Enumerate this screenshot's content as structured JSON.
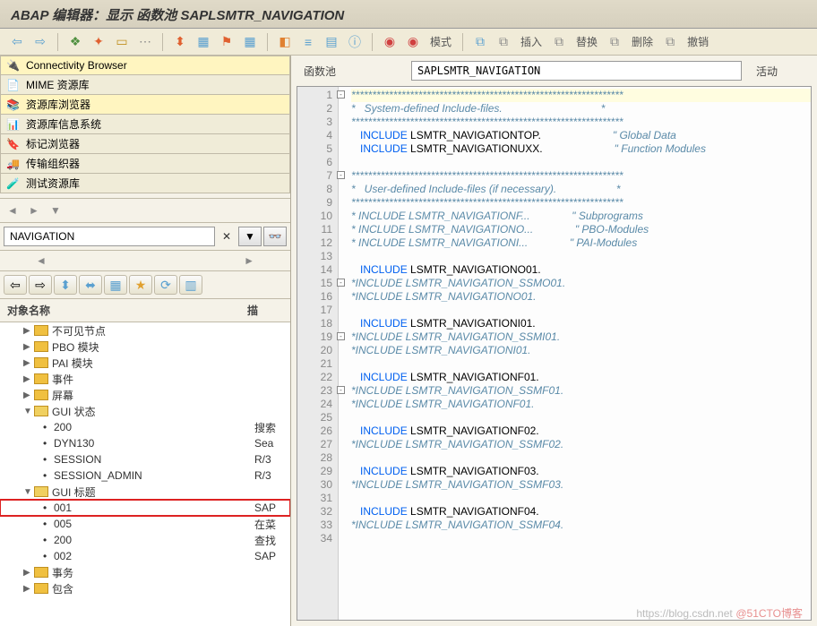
{
  "title": "ABAP 编辑器：显示 函数池 SAPLSMTR_NAVIGATION",
  "toolbar": {
    "mode": "模式",
    "insert": "插入",
    "replace": "替换",
    "delete": "删除",
    "undo": "撤销"
  },
  "browsers": [
    {
      "label": "Connectivity Browser",
      "hl": true
    },
    {
      "label": "MIME 资源库"
    },
    {
      "label": "资源库浏览器",
      "hl": true
    },
    {
      "label": "资源库信息系统"
    },
    {
      "label": "标记浏览器"
    },
    {
      "label": "传输组织器"
    },
    {
      "label": "测试资源库"
    }
  ],
  "search": {
    "value": "NAVIGATION"
  },
  "tree": {
    "header": {
      "c1": "对象名称",
      "c2": "描"
    },
    "nodes": [
      {
        "indent": 1,
        "exp": "▶",
        "folder": 1,
        "label": "不可见节点"
      },
      {
        "indent": 1,
        "exp": "▶",
        "folder": 1,
        "label": "PBO 模块"
      },
      {
        "indent": 1,
        "exp": "▶",
        "folder": 1,
        "label": "PAI 模块"
      },
      {
        "indent": 1,
        "exp": "▶",
        "folder": 1,
        "label": "事件"
      },
      {
        "indent": 1,
        "exp": "▶",
        "folder": 1,
        "label": "屏幕"
      },
      {
        "indent": 1,
        "exp": "▼",
        "folder": 2,
        "label": "GUI 状态"
      },
      {
        "indent": 2,
        "dot": 1,
        "label": "200",
        "desc": "搜索"
      },
      {
        "indent": 2,
        "dot": 1,
        "label": "DYN130",
        "desc": "Sea"
      },
      {
        "indent": 2,
        "dot": 1,
        "label": "SESSION",
        "desc": "R/3"
      },
      {
        "indent": 2,
        "dot": 1,
        "label": "SESSION_ADMIN",
        "desc": "R/3"
      },
      {
        "indent": 1,
        "exp": "▼",
        "folder": 2,
        "label": "GUI 标题"
      },
      {
        "indent": 2,
        "dot": 1,
        "label": "001",
        "desc": "SAP",
        "red": true
      },
      {
        "indent": 2,
        "dot": 1,
        "label": "005",
        "desc": "在菜"
      },
      {
        "indent": 2,
        "dot": 1,
        "label": "200",
        "desc": "查找"
      },
      {
        "indent": 2,
        "dot": 1,
        "label": "002",
        "desc": "SAP"
      },
      {
        "indent": 1,
        "exp": "▶",
        "folder": 1,
        "label": "事务"
      },
      {
        "indent": 1,
        "exp": "▶",
        "folder": 1,
        "label": "包含"
      }
    ]
  },
  "object": {
    "type_label": "函数池",
    "name": "SAPLSMTR_NAVIGATION",
    "status": "活动"
  },
  "code": [
    {
      "n": 1,
      "fold": "-",
      "cm": "*****************************************************************"
    },
    {
      "n": 2,
      "cm": "*   System-defined Include-files.                                 *"
    },
    {
      "n": 3,
      "cm": "*****************************************************************"
    },
    {
      "n": 4,
      "kw": "INCLUDE",
      "id": "LSMTR_NAVIGATIONTOP.",
      "rc": "\" Global Data"
    },
    {
      "n": 5,
      "kw": "INCLUDE",
      "id": "LSMTR_NAVIGATIONUXX.",
      "rc": "\" Function Modules"
    },
    {
      "n": 6,
      "blank": true
    },
    {
      "n": 7,
      "fold": "-",
      "cm": "*****************************************************************"
    },
    {
      "n": 8,
      "cm": "*   User-defined Include-files (if necessary).                    *"
    },
    {
      "n": 9,
      "cm": "*****************************************************************"
    },
    {
      "n": 10,
      "cm": "* INCLUDE LSMTR_NAVIGATIONF...              \" Subprograms"
    },
    {
      "n": 11,
      "cm": "* INCLUDE LSMTR_NAVIGATIONO...              \" PBO-Modules"
    },
    {
      "n": 12,
      "cm": "* INCLUDE LSMTR_NAVIGATIONI...              \" PAI-Modules"
    },
    {
      "n": 13,
      "blank": true
    },
    {
      "n": 14,
      "kw": "INCLUDE",
      "id": "LSMTR_NAVIGATIONO01."
    },
    {
      "n": 15,
      "fold": "-",
      "cm": "*INCLUDE LSMTR_NAVIGATION_SSMO01."
    },
    {
      "n": 16,
      "cm": "*INCLUDE LSMTR_NAVIGATIONO01."
    },
    {
      "n": 17,
      "blank": true
    },
    {
      "n": 18,
      "kw": "INCLUDE",
      "id": "LSMTR_NAVIGATIONI01."
    },
    {
      "n": 19,
      "fold": "-",
      "cm": "*INCLUDE LSMTR_NAVIGATION_SSMI01."
    },
    {
      "n": 20,
      "cm": "*INCLUDE LSMTR_NAVIGATIONI01."
    },
    {
      "n": 21,
      "blank": true
    },
    {
      "n": 22,
      "kw": "INCLUDE",
      "id": "LSMTR_NAVIGATIONF01."
    },
    {
      "n": 23,
      "fold": "-",
      "cm": "*INCLUDE LSMTR_NAVIGATION_SSMF01."
    },
    {
      "n": 24,
      "cm": "*INCLUDE LSMTR_NAVIGATIONF01."
    },
    {
      "n": 25,
      "blank": true
    },
    {
      "n": 26,
      "kw": "INCLUDE",
      "id": "LSMTR_NAVIGATIONF02."
    },
    {
      "n": 27,
      "cm": "*INCLUDE LSMTR_NAVIGATION_SSMF02."
    },
    {
      "n": 28,
      "blank": true
    },
    {
      "n": 29,
      "kw": "INCLUDE",
      "id": "LSMTR_NAVIGATIONF03."
    },
    {
      "n": 30,
      "cm": "*INCLUDE LSMTR_NAVIGATION_SSMF03."
    },
    {
      "n": 31,
      "blank": true
    },
    {
      "n": 32,
      "kw": "INCLUDE",
      "id": "LSMTR_NAVIGATIONF04."
    },
    {
      "n": 33,
      "cm": "*INCLUDE LSMTR_NAVIGATION_SSMF04."
    },
    {
      "n": 34,
      "blank": true
    }
  ],
  "watermark": {
    "a": "https://blog.csdn.net",
    "b": "@51CTO博客"
  }
}
